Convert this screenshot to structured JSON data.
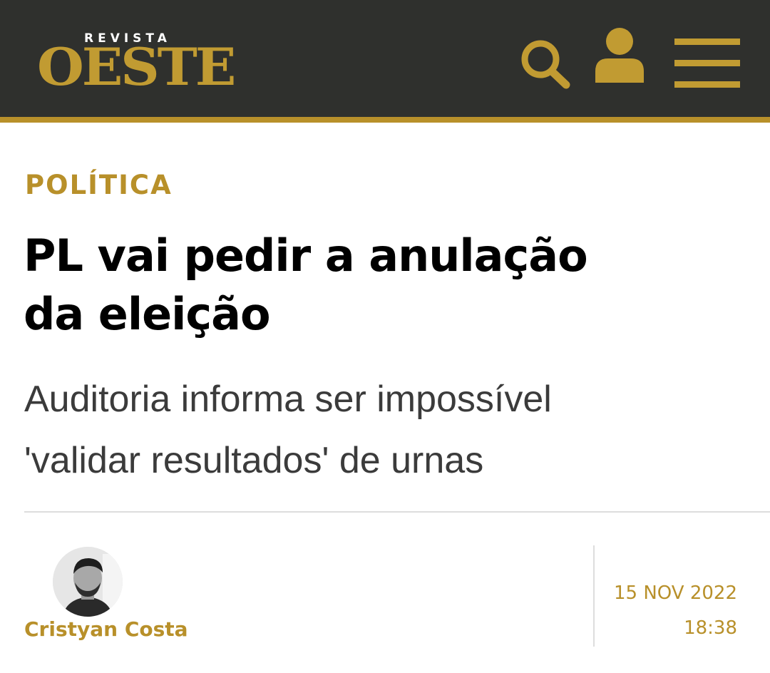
{
  "header": {
    "logo_small": "REVISTA",
    "logo_big": "OESTE",
    "icons": [
      "search-icon",
      "user-icon",
      "hamburger-menu-icon"
    ]
  },
  "article": {
    "category": "POLÍTICA",
    "headline_line1": "PL vai pedir a anulação",
    "headline_line2": "da eleição",
    "subtitle_line1": "Auditoria informa ser impossível",
    "subtitle_line2": "'validar resultados' de urnas"
  },
  "byline": {
    "author": "Cristyan Costa",
    "date": "15 NOV 2022",
    "time": "18:38"
  },
  "colors": {
    "header_bg": "#2f302d",
    "accent": "#b8902a",
    "headline": "#000000",
    "subtitle": "#3b3b3b"
  }
}
